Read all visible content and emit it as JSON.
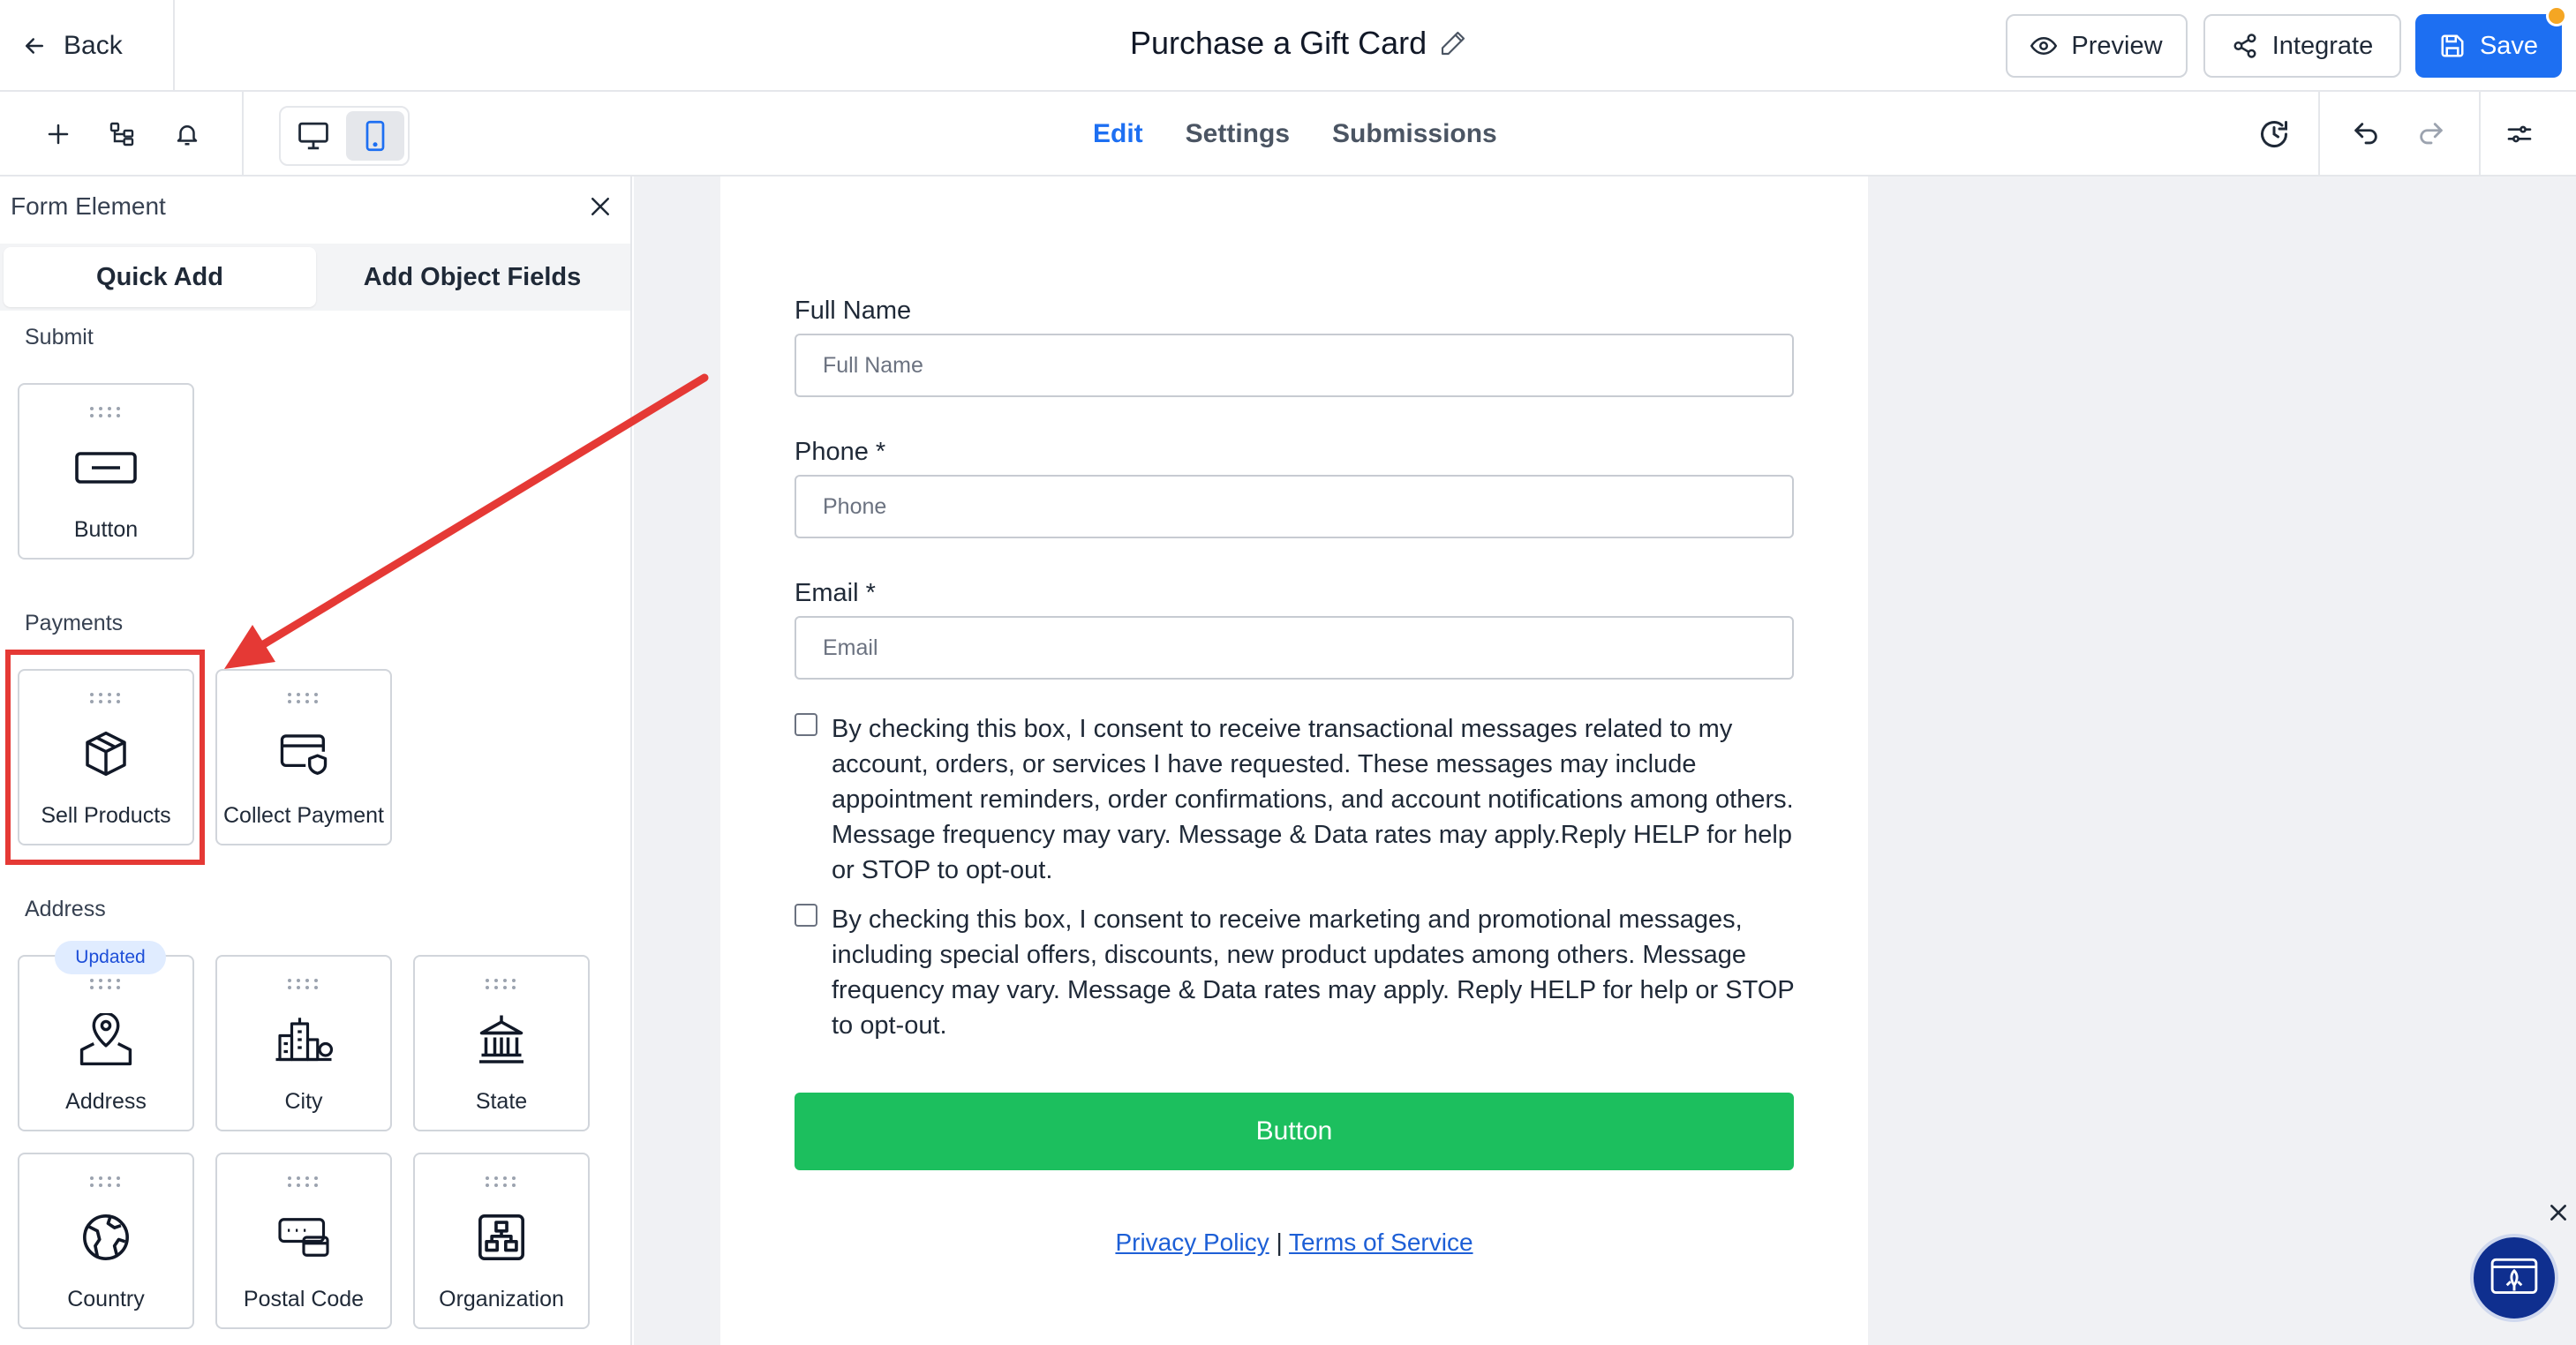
{
  "topbar": {
    "back_label": "Back",
    "title": "Purchase a Gift Card",
    "preview_label": "Preview",
    "integrate_label": "Integrate",
    "save_label": "Save"
  },
  "toolbar": {
    "tabs": [
      {
        "label": "Edit",
        "active": true
      },
      {
        "label": "Settings",
        "active": false
      },
      {
        "label": "Submissions",
        "active": false
      }
    ],
    "device_active": "mobile"
  },
  "panel": {
    "title": "Form Element",
    "segments": [
      {
        "label": "Quick Add",
        "active": true
      },
      {
        "label": "Add Object Fields",
        "active": false
      }
    ],
    "sections": [
      {
        "label": "Submit",
        "items": [
          {
            "label": "Button",
            "icon": "button-icon"
          }
        ]
      },
      {
        "label": "Payments",
        "items": [
          {
            "label": "Sell Products",
            "icon": "box-icon",
            "highlighted": true
          },
          {
            "label": "Collect Payment",
            "icon": "card-shield-icon"
          }
        ]
      },
      {
        "label": "Address",
        "items": [
          {
            "label": "Address",
            "icon": "map-pin-icon",
            "badge": "Updated"
          },
          {
            "label": "City",
            "icon": "city-icon"
          },
          {
            "label": "State",
            "icon": "capitol-icon"
          },
          {
            "label": "Country",
            "icon": "globe-icon"
          },
          {
            "label": "Postal Code",
            "icon": "mailbox-icon"
          },
          {
            "label": "Organization",
            "icon": "org-chart-icon"
          }
        ]
      }
    ]
  },
  "form": {
    "fields": [
      {
        "label": "Full Name",
        "placeholder": "Full Name"
      },
      {
        "label": "Phone *",
        "placeholder": "Phone"
      },
      {
        "label": "Email *",
        "placeholder": "Email"
      }
    ],
    "consents": [
      "By checking this box, I consent to receive transactional messages related to my account, orders, or services I have requested. These messages may include appointment reminders, order confirmations, and account notifications among others. Message frequency may vary. Message & Data rates may apply.Reply HELP for help or STOP to opt-out.",
      "By checking this box, I consent to receive marketing and promotional messages, including special offers, discounts, new product updates among others. Message frequency may vary. Message & Data rates may apply. Reply HELP for help or STOP to opt-out."
    ],
    "button_label": "Button",
    "privacy_link": "Privacy Policy",
    "separator": "|",
    "terms_link": "Terms of Service"
  },
  "colors": {
    "accent": "#1d6ff2",
    "submit_green": "#1cbf5e",
    "highlight_red": "#e53935"
  }
}
